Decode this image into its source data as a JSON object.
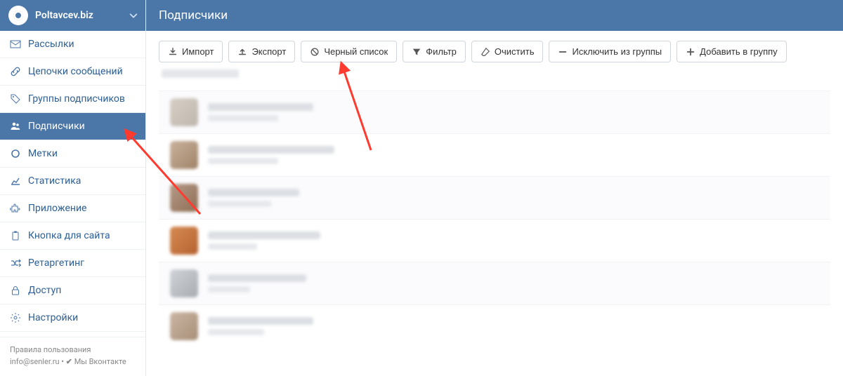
{
  "brand": {
    "name": "Poltavcev.biz"
  },
  "header": {
    "title": "Подписчики"
  },
  "sidebar": {
    "items": [
      {
        "label": "Рассылки",
        "icon": "envelope-icon",
        "active": false
      },
      {
        "label": "Цепочки сообщений",
        "icon": "link-icon",
        "active": false
      },
      {
        "label": "Группы подписчиков",
        "icon": "tags-icon",
        "active": false
      },
      {
        "label": "Подписчики",
        "icon": "users-icon",
        "active": true
      },
      {
        "label": "Метки",
        "icon": "circle-icon",
        "active": false
      },
      {
        "label": "Статистика",
        "icon": "chart-icon",
        "active": false
      },
      {
        "label": "Приложение",
        "icon": "puzzle-icon",
        "active": false
      },
      {
        "label": "Кнопка для сайта",
        "icon": "clipboard-icon",
        "active": false
      },
      {
        "label": "Ретаргетинг",
        "icon": "shuffle-icon",
        "active": false
      },
      {
        "label": "Доступ",
        "icon": "lock-icon",
        "active": false
      },
      {
        "label": "Настройки",
        "icon": "gear-icon",
        "active": false
      }
    ]
  },
  "toolbar": {
    "import": {
      "label": "Импорт"
    },
    "export": {
      "label": "Экспорт"
    },
    "blacklist": {
      "label": "Черный список"
    },
    "filter": {
      "label": "Фильтр"
    },
    "clear": {
      "label": "Очистить"
    },
    "exclude": {
      "label": "Исключить из группы"
    },
    "add": {
      "label": "Добавить в группу"
    }
  },
  "footer": {
    "terms": "Правила пользования",
    "email": "info@senler.ru",
    "dot": " • ",
    "vk_prefix": "Мы Вконтакте"
  },
  "subscribers": {
    "rows": [
      {},
      {},
      {},
      {},
      {},
      {}
    ]
  },
  "colors": {
    "primary": "#4a76a8",
    "annotation": "#ff3b30"
  }
}
